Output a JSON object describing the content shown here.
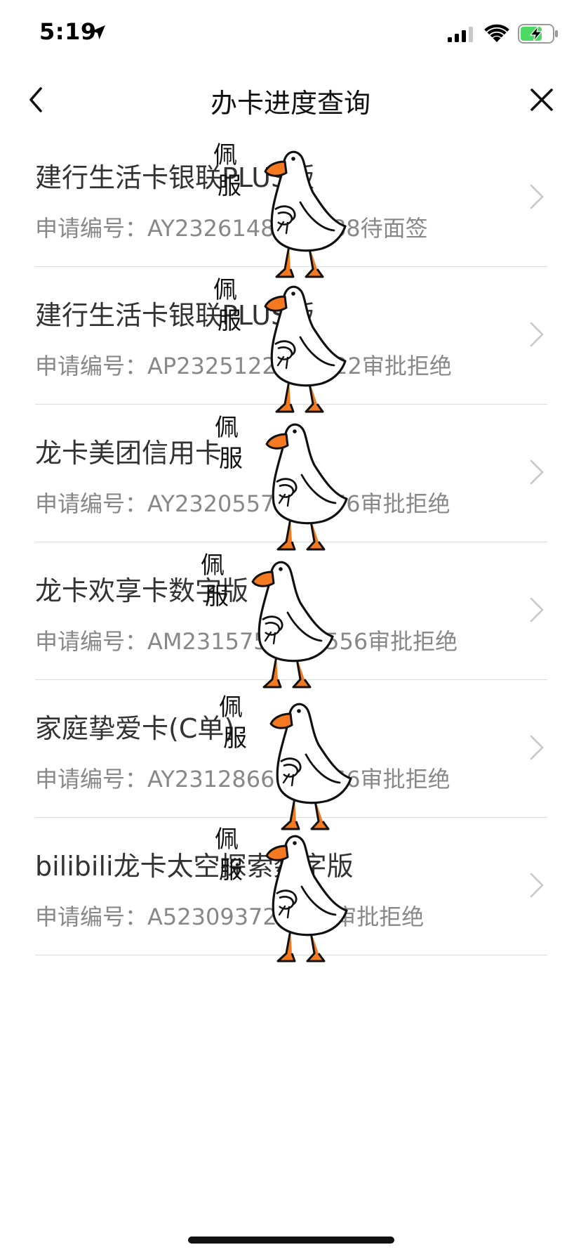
{
  "status_bar": {
    "time": "5:19",
    "location_icon": "location-arrow-icon",
    "signal_icon": "cellular-signal-icon",
    "wifi_icon": "wifi-icon",
    "battery_icon": "battery-charging-icon",
    "battery_color": "#4cd964"
  },
  "nav": {
    "title": "办卡进度查询",
    "back_icon": "chevron-left-icon",
    "close_icon": "close-icon"
  },
  "applications": [
    {
      "card_name": "建行生活卡银联PLUS版",
      "app_line": "申请编号：AY2326148888888待面签"
    },
    {
      "card_name": "建行生活卡银联PLUS版",
      "app_line": "申请编号：AP2325122222222审批拒绝"
    },
    {
      "card_name": "龙卡美团信用卡",
      "app_line": "申请编号：AY2320557777776审批拒绝"
    },
    {
      "card_name": "龙卡欢享卡数字版",
      "app_line": "申请编号：AM2315755555556审批拒绝"
    },
    {
      "card_name": "家庭挚爱卡(C单)",
      "app_line": "申请编号：AY2312866666666审批拒绝"
    },
    {
      "card_name": "bilibili龙卡太空探索数字版",
      "app_line": "申请编号：A523093722222审批拒绝"
    }
  ],
  "sticker": {
    "text": "佩服",
    "char_1": "佩",
    "char_2": "服",
    "icon": "goose-sticker-icon",
    "beak_color": "#f47920"
  },
  "colors": {
    "title": "#111111",
    "card_name": "#333333",
    "app_line": "#888888",
    "divider": "#dcdcdc",
    "chevron": "#c7c7cc"
  }
}
